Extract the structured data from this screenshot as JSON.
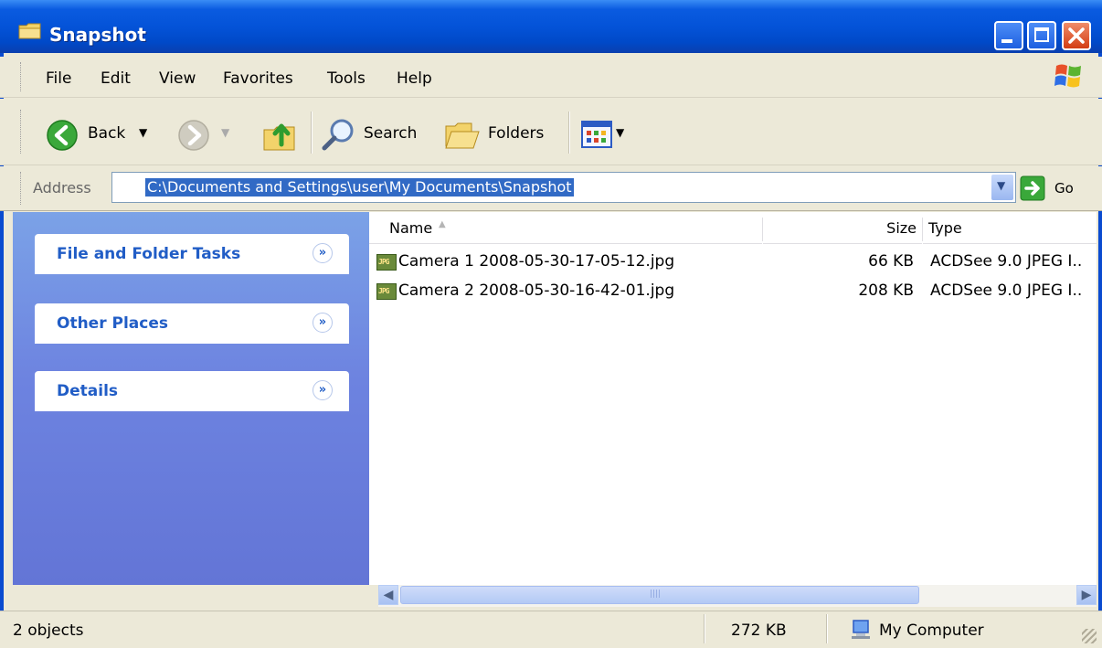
{
  "window": {
    "title": "Snapshot",
    "minimize_icon": "minimize-icon",
    "maximize_icon": "maximize-icon",
    "close_icon": "close-icon"
  },
  "menu": [
    "File",
    "Edit",
    "View",
    "Favorites",
    "Tools",
    "Help"
  ],
  "toolbar": {
    "back_label": "Back",
    "search_label": "Search",
    "folders_label": "Folders"
  },
  "address": {
    "label": "Address",
    "value": "C:\\Documents and Settings\\user\\My Documents\\Snapshot",
    "go_label": "Go"
  },
  "tasks": [
    {
      "title": "File and Folder Tasks"
    },
    {
      "title": "Other Places"
    },
    {
      "title": "Details"
    }
  ],
  "columns": {
    "name": "Name",
    "size": "Size",
    "type": "Type"
  },
  "files": [
    {
      "name": "Camera 1 2008-05-30-17-05-12.jpg",
      "size": "66 KB",
      "type": "ACDSee 9.0 JPEG I.."
    },
    {
      "name": "Camera 2 2008-05-30-16-42-01.jpg",
      "size": "208 KB",
      "type": "ACDSee 9.0 JPEG I.."
    }
  ],
  "status": {
    "objects": "2 objects",
    "total_size": "272 KB",
    "location": "My Computer"
  },
  "colors": {
    "titlebar": "#0453d8",
    "selection": "#316AC5",
    "task_title": "#215dc6",
    "taskpane": "#6d83e0"
  }
}
